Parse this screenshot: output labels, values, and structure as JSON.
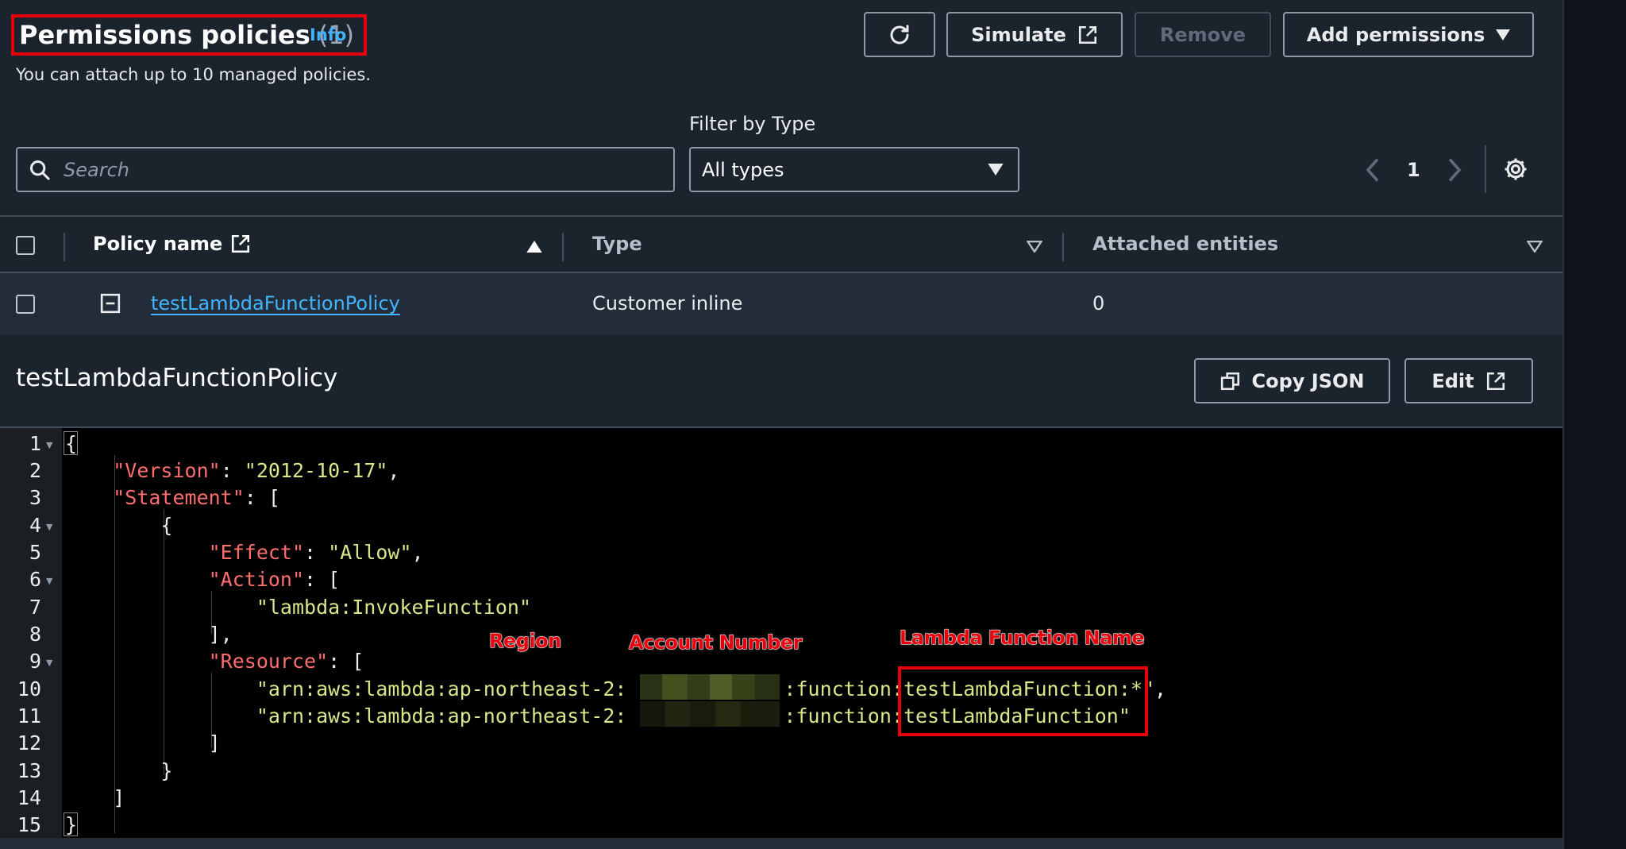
{
  "header": {
    "title": "Permissions policies",
    "count": "(1)",
    "info": "Info",
    "subtitle": "You can attach up to 10 managed policies."
  },
  "toolbar": {
    "simulate": "Simulate",
    "remove": "Remove",
    "add_permissions": "Add permissions"
  },
  "filters": {
    "filter_label": "Filter by Type",
    "search_placeholder": "Search",
    "type_selected": "All types",
    "page": "1"
  },
  "table": {
    "columns": [
      "Policy name",
      "Type",
      "Attached entities"
    ],
    "rows": [
      {
        "policy_name": "testLambdaFunctionPolicy",
        "type": "Customer inline",
        "attached": "0"
      }
    ]
  },
  "policy": {
    "title": "testLambdaFunctionPolicy",
    "copy_json": "Copy JSON",
    "edit": "Edit"
  },
  "code": {
    "line_numbers": [
      "1",
      "2",
      "3",
      "4",
      "5",
      "6",
      "7",
      "8",
      "9",
      "10",
      "11",
      "12",
      "13",
      "14",
      "15"
    ],
    "version_key": "\"Version\"",
    "version_val": "\"2012-10-17\"",
    "statement_key": "\"Statement\"",
    "effect_key": "\"Effect\"",
    "effect_val": "\"Allow\"",
    "action_key": "\"Action\"",
    "action_val": "\"lambda:InvokeFunction\"",
    "resource_key": "\"Resource\"",
    "arn_prefix": "\"arn:aws:lambda:ap-northeast-2:",
    "arn_mid": ":function:",
    "resource_1_name": "testLambdaFunction:*\"",
    "resource_2_name": "testLambdaFunction\""
  },
  "annotations": {
    "region": "Region",
    "account": "Account Number",
    "function_name": "Lambda Function Name"
  },
  "colors": {
    "accent_red": "#e8000d",
    "link_blue": "#42b4ff",
    "json_key": "#ff6e6e",
    "json_string": "#d6e887"
  }
}
